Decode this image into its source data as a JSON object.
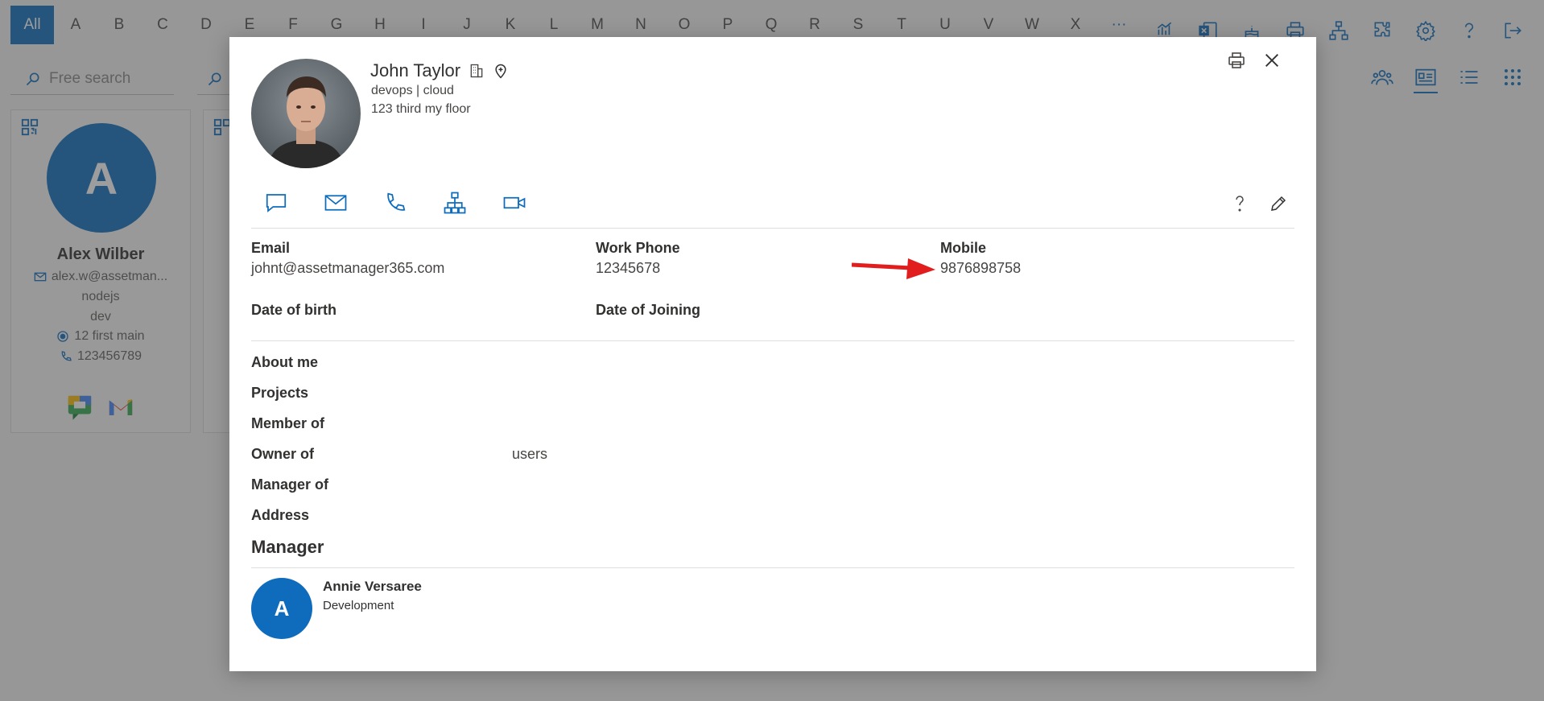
{
  "alphabet": {
    "items": [
      "All",
      "A",
      "B",
      "C",
      "D",
      "E",
      "F",
      "G",
      "H",
      "I",
      "J",
      "K",
      "L",
      "M",
      "N",
      "O",
      "P",
      "Q",
      "R",
      "S",
      "T",
      "U",
      "V",
      "W",
      "X",
      "···"
    ],
    "active_index": 0
  },
  "toolbar_icons": [
    "chart-icon",
    "excel-icon",
    "cake-icon",
    "print-icon",
    "org-chart-icon",
    "puzzle-icon",
    "settings-icon",
    "help-icon",
    "sign-out-icon"
  ],
  "search": {
    "placeholder": "Free search"
  },
  "view_icons": [
    "team-icon",
    "card-view-icon",
    "list-view-icon",
    "grid-view-icon"
  ],
  "card": {
    "initial": "A",
    "name": "Alex Wilber",
    "email": "alex.w@assetman...",
    "line1": "nodejs",
    "line2": "dev",
    "address": "12 first main",
    "phone": "123456789"
  },
  "colors": {
    "accent": "#0f6cbd",
    "arrow": "#e11d1d"
  },
  "profile": {
    "name": "John Taylor",
    "dept": "devops | cloud",
    "address": "123 third my floor"
  },
  "fields": {
    "email_label": "Email",
    "email_value": "johnt@assetmanager365.com",
    "work_phone_label": "Work Phone",
    "work_phone_value": "12345678",
    "mobile_label": "Mobile",
    "mobile_value": "9876898758",
    "dob_label": "Date of birth",
    "doj_label": "Date of Joining"
  },
  "about": {
    "about_me": "About me",
    "projects": "Projects",
    "member_of": "Member of",
    "owner_of": "Owner of",
    "owner_of_value": "users",
    "manager_of": "Manager of",
    "address": "Address"
  },
  "manager": {
    "title": "Manager",
    "initial": "A",
    "name": "Annie Versaree",
    "dept": "Development"
  }
}
